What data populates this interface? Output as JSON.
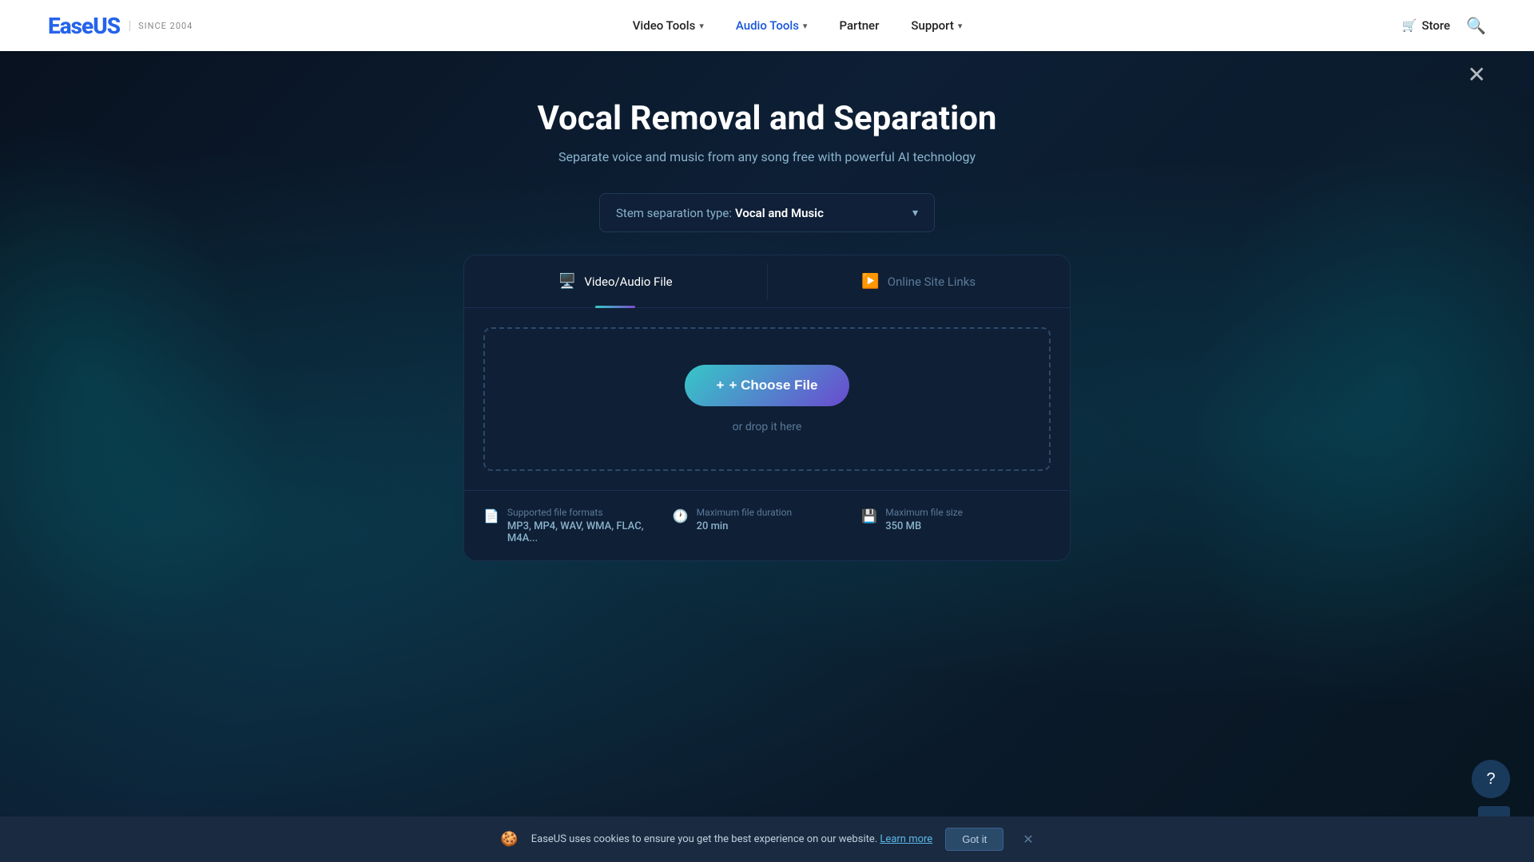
{
  "navbar": {
    "logo": "EaseUS",
    "logo_since": "SINCE 2004",
    "nav_items": [
      {
        "label": "Video Tools",
        "has_dropdown": true
      },
      {
        "label": "Audio Tools",
        "has_dropdown": true
      },
      {
        "label": "Partner",
        "has_dropdown": false
      },
      {
        "label": "Support",
        "has_dropdown": true
      }
    ],
    "store_label": "Store",
    "search_icon": "🔍"
  },
  "page": {
    "title": "Vocal Removal and Separation",
    "subtitle": "Separate voice and music from any song free with powerful AI technology",
    "close_icon": "✕"
  },
  "stem_dropdown": {
    "label": "Stem separation type:",
    "value": "Vocal and Music",
    "chevron": "▾"
  },
  "upload_card": {
    "tab_audio": "Video/Audio File",
    "tab_online": "Online Site Links",
    "choose_file_label": "+ Choose File",
    "drop_text": "or drop it here",
    "info_items": [
      {
        "icon": "📄",
        "label": "Supported file formats",
        "value": "MP3, MP4, WAV, WMA, FLAC, M4A..."
      },
      {
        "icon": "🕐",
        "label": "Maximum file duration",
        "value": "20 min"
      },
      {
        "icon": "💾",
        "label": "Maximum file size",
        "value": "350 MB"
      }
    ]
  },
  "cookie_bar": {
    "icon": "🍪",
    "text": "EaseUS uses cookies to ensure you get the best experience on our website.",
    "learn_more": "Learn more",
    "got_it": "Got it"
  },
  "help_btn": "?",
  "scroll_top": "▲"
}
